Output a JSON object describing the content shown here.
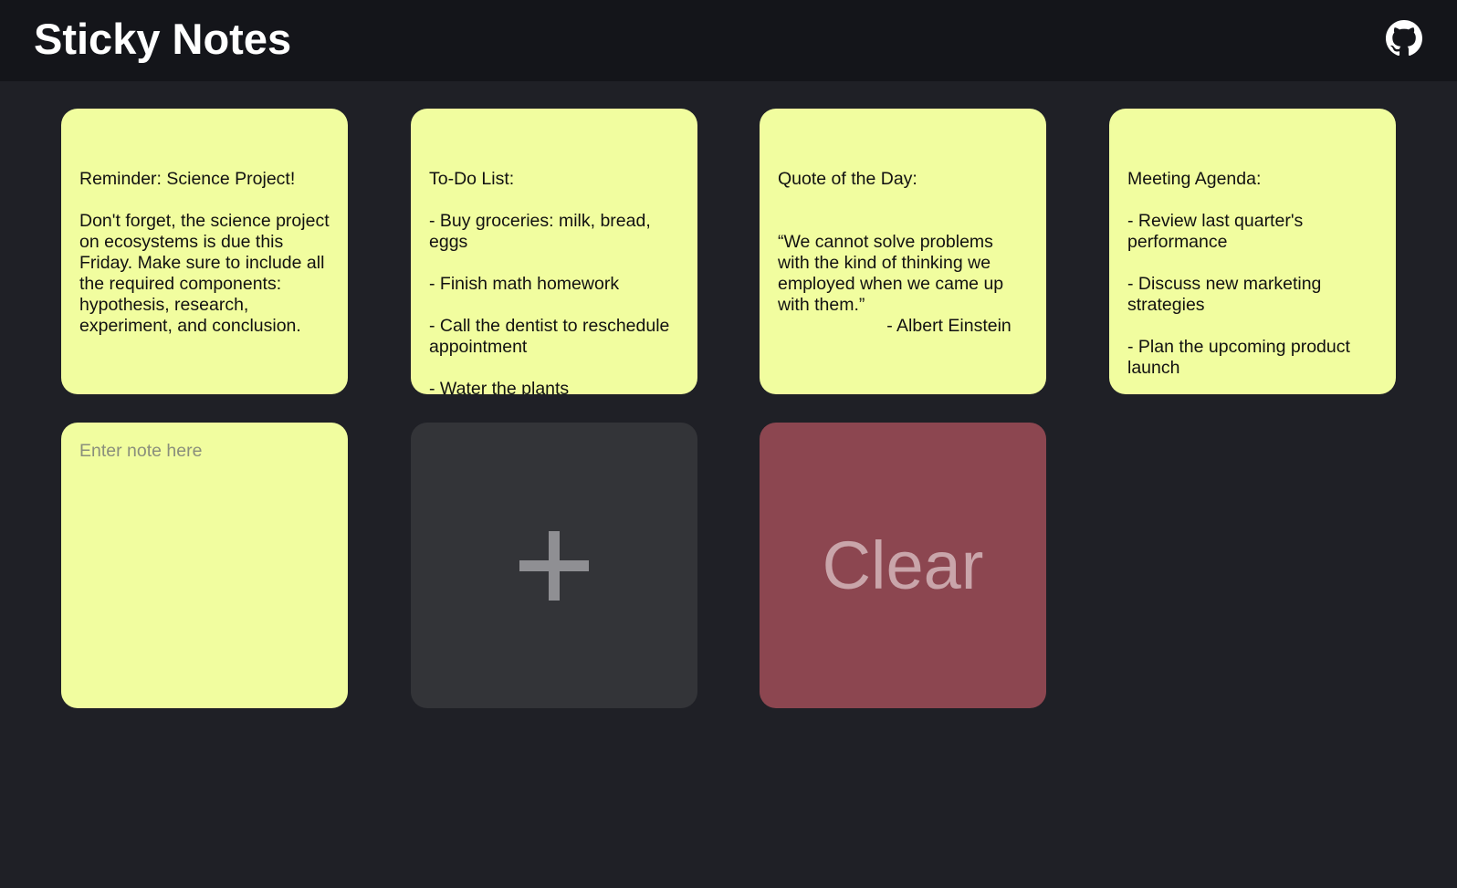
{
  "header": {
    "title": "Sticky Notes",
    "github_icon": "github-icon"
  },
  "notes": [
    {
      "text": "Reminder: Science Project!\n\nDon't forget, the science project on ecosystems is due this Friday. Make sure to include all the required components: hypothesis, research, experiment, and conclusion."
    },
    {
      "text": "To-Do List:\n\n- Buy groceries: milk, bread, eggs\n\n- Finish math homework\n\n- Call the dentist to reschedule appointment\n\n- Water the plants"
    },
    {
      "text": "Quote of the Day:\n\n\n“We cannot solve problems with the kind of thinking we employed when we came up with them.”\n                      - Albert Einstein"
    },
    {
      "text": "Meeting Agenda:\n\n- Review last quarter's performance\n\n- Discuss new marketing strategies\n\n- Plan the upcoming product launch"
    }
  ],
  "new_note": {
    "value": "",
    "placeholder": "Enter note here"
  },
  "add_button": {
    "icon": "plus-icon"
  },
  "clear_button": {
    "label": "Clear"
  },
  "colors": {
    "background": "#1f2026",
    "header_background": "#14151a",
    "note": "#f1fd9f",
    "add_button": "#333438",
    "clear_button": "#8c4650"
  }
}
